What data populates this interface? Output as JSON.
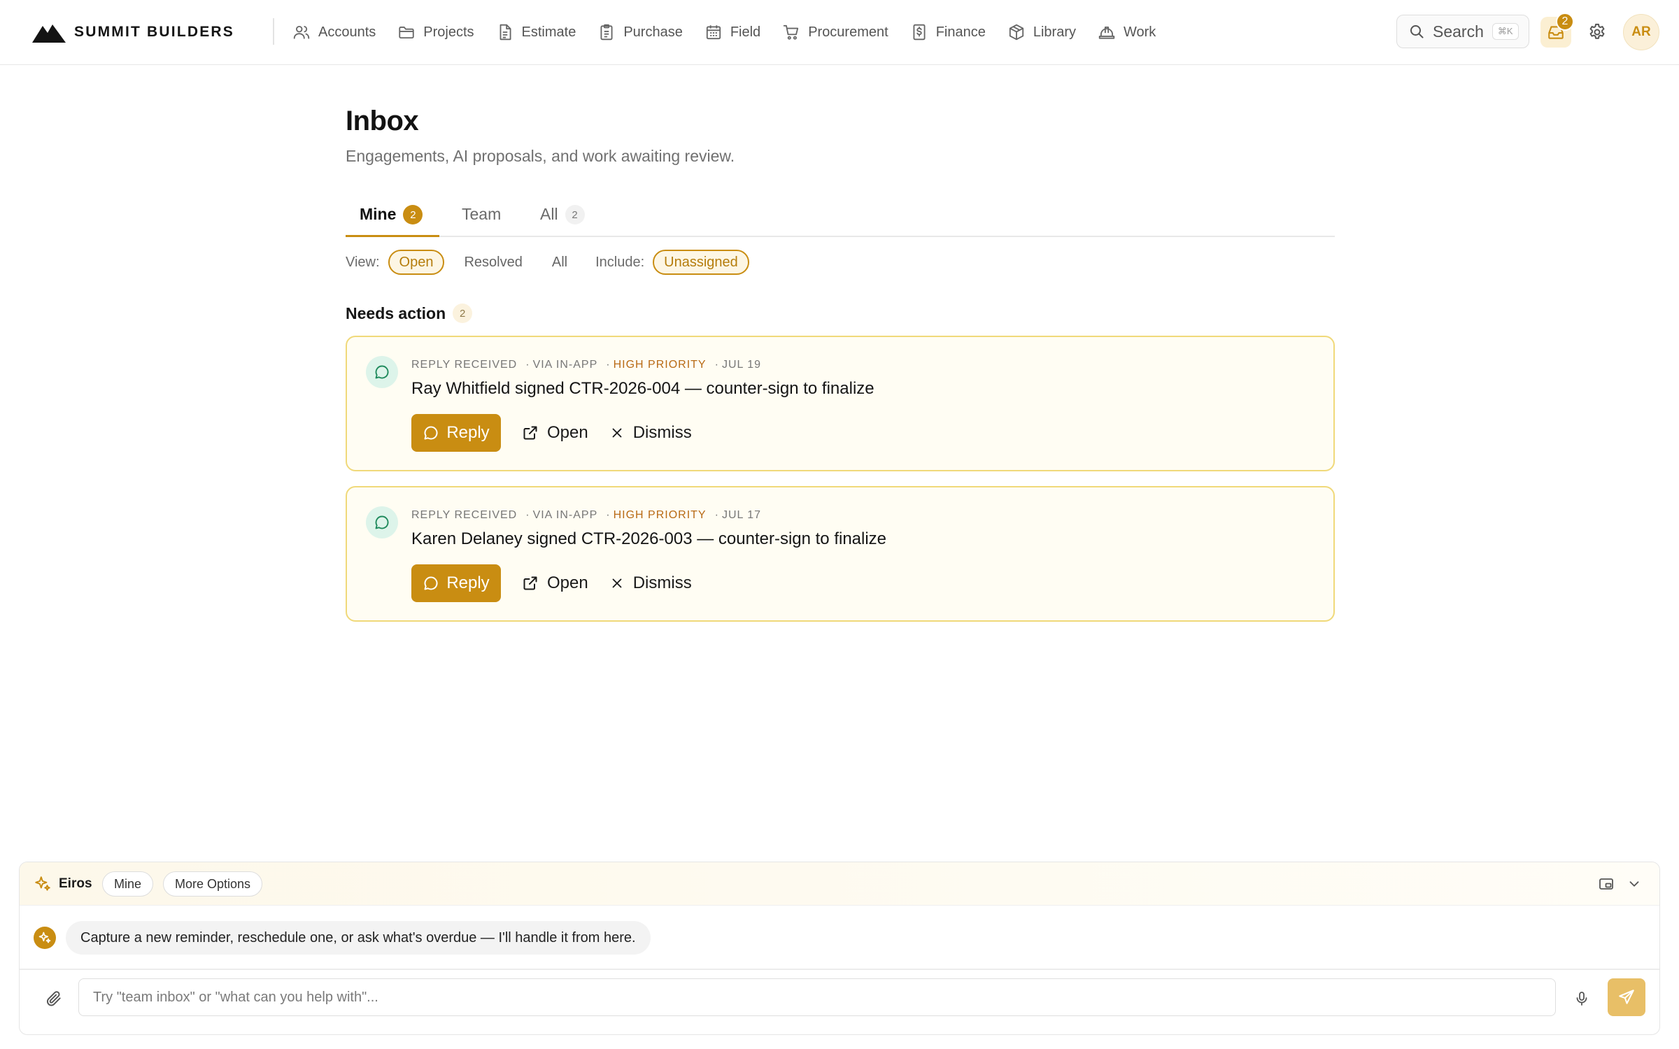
{
  "colors": {
    "accent": "#c98d12",
    "accent_soft": "#fdf6e4",
    "card_border": "#f0d97a",
    "priority": "#b86a15",
    "chat_icon_bg": "#ddf4ea"
  },
  "header": {
    "brand": "SUMMIT BUILDERS",
    "nav": [
      {
        "label": "Accounts",
        "icon": "users-icon"
      },
      {
        "label": "Projects",
        "icon": "folder-icon"
      },
      {
        "label": "Estimate",
        "icon": "document-icon"
      },
      {
        "label": "Purchase",
        "icon": "clipboard-icon"
      },
      {
        "label": "Field",
        "icon": "calendar-icon"
      },
      {
        "label": "Procurement",
        "icon": "cart-icon"
      },
      {
        "label": "Finance",
        "icon": "dollar-doc-icon"
      },
      {
        "label": "Library",
        "icon": "box-icon"
      },
      {
        "label": "Work",
        "icon": "hardhat-icon"
      }
    ],
    "search": {
      "label": "Search",
      "shortcut": "⌘K"
    },
    "inbox_badge": "2",
    "avatar": "AR"
  },
  "page": {
    "title": "Inbox",
    "subtitle": "Engagements, AI proposals, and work awaiting review."
  },
  "tabs": [
    {
      "label": "Mine",
      "count": "2",
      "active": true
    },
    {
      "label": "Team",
      "count": "",
      "active": false
    },
    {
      "label": "All",
      "count": "2",
      "active": false
    }
  ],
  "filters": {
    "view_label": "View:",
    "views": [
      {
        "label": "Open",
        "selected": true
      },
      {
        "label": "Resolved",
        "selected": false
      },
      {
        "label": "All",
        "selected": false
      }
    ],
    "include_label": "Include:",
    "include": {
      "label": "Unassigned",
      "selected": true
    }
  },
  "section": {
    "title": "Needs action",
    "count": "2"
  },
  "items": [
    {
      "type": "REPLY RECEIVED",
      "channel": "VIA IN-APP",
      "priority": "HIGH PRIORITY",
      "date": "JUL 19",
      "title": "Ray Whitfield signed CTR-2026-004 — counter-sign to finalize",
      "actions": {
        "reply": "Reply",
        "open": "Open",
        "dismiss": "Dismiss"
      }
    },
    {
      "type": "REPLY RECEIVED",
      "channel": "VIA IN-APP",
      "priority": "HIGH PRIORITY",
      "date": "JUL 17",
      "title": "Karen Delaney signed CTR-2026-003 — counter-sign to finalize",
      "actions": {
        "reply": "Reply",
        "open": "Open",
        "dismiss": "Dismiss"
      }
    }
  ],
  "assistant": {
    "name": "Eiros",
    "scope": "Mine",
    "more": "More Options",
    "message": "Capture a new reminder, reschedule one, or ask what's overdue — I'll handle it from here.",
    "placeholder": "Try \"team inbox\" or \"what can you help with\"..."
  }
}
